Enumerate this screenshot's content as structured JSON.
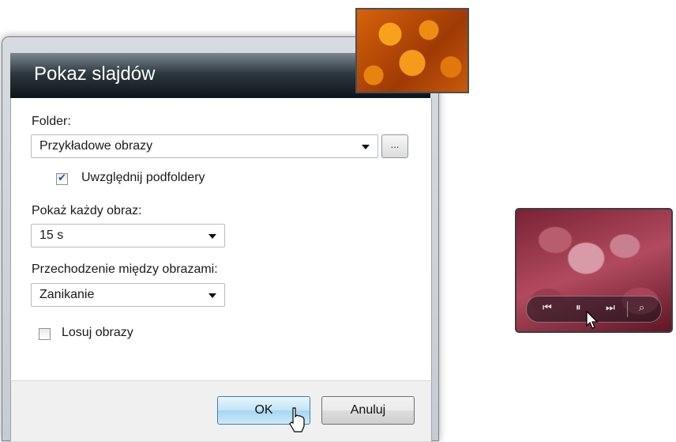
{
  "dialog": {
    "title": "Pokaz slajdów",
    "folder_label": "Folder:",
    "folder_value": "Przykładowe obrazy",
    "browse_label": "...",
    "include_subfolders_label": "Uwzględnij podfoldery",
    "include_subfolders_checked": true,
    "show_each_label": "Pokaż każdy obraz:",
    "show_each_value": "15 s",
    "transition_label": "Przechodzenie między obrazami:",
    "transition_value": "Zanikanie",
    "shuffle_label": "Losuj obrazy",
    "shuffle_checked": false,
    "ok_label": "OK",
    "cancel_label": "Anuluj"
  },
  "gadget": {
    "controls": [
      "previous-icon",
      "pause-icon",
      "next-icon",
      "view-icon"
    ]
  }
}
